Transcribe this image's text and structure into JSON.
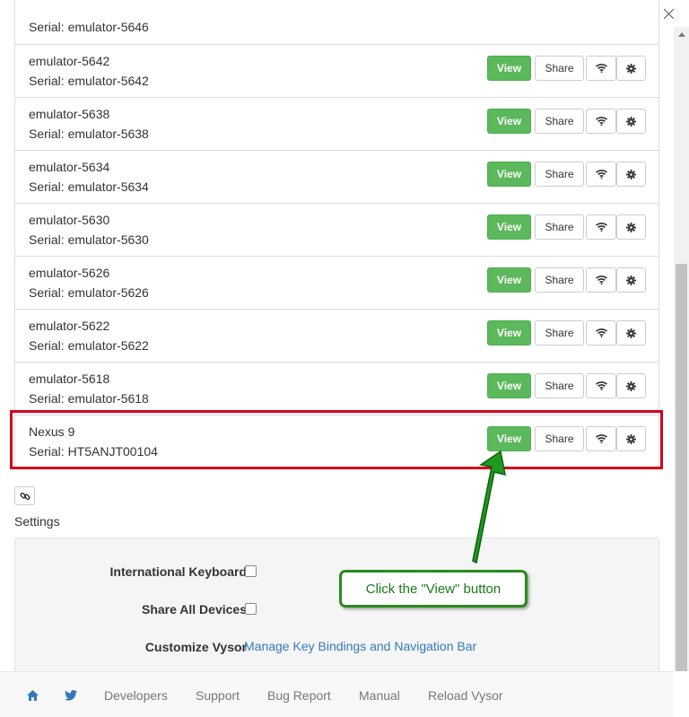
{
  "window": {
    "minimize_label": "—",
    "maximize_label": "☐",
    "close_label": "✕"
  },
  "partial_row": {
    "serial": "Serial: emulator-5646"
  },
  "devices": [
    {
      "name": "emulator-5642",
      "serial": "Serial: emulator-5642"
    },
    {
      "name": "emulator-5638",
      "serial": "Serial: emulator-5638"
    },
    {
      "name": "emulator-5634",
      "serial": "Serial: emulator-5634"
    },
    {
      "name": "emulator-5630",
      "serial": "Serial: emulator-5630"
    },
    {
      "name": "emulator-5626",
      "serial": "Serial: emulator-5626"
    },
    {
      "name": "emulator-5622",
      "serial": "Serial: emulator-5622"
    },
    {
      "name": "emulator-5618",
      "serial": "Serial: emulator-5618"
    },
    {
      "name": "Nexus 9",
      "serial": "Serial: HT5ANJT00104"
    }
  ],
  "buttons": {
    "view": "View",
    "share": "Share"
  },
  "settings": {
    "title": "Settings",
    "international_keyboard": "International Keyboard",
    "share_all_devices": "Share All Devices",
    "customize_vysor": "Customize Vysor",
    "manage_link": "Manage Key Bindings and Navigation Bar"
  },
  "callout": {
    "text": "Click the \"View\" button"
  },
  "footer": {
    "developers": "Developers",
    "support": "Support",
    "bug_report": "Bug Report",
    "manual": "Manual",
    "reload": "Reload Vysor"
  },
  "colors": {
    "view_button": "#5cb85c",
    "highlight_border": "#d0021b",
    "callout_border": "#2a8a1f",
    "link": "#337ab7"
  }
}
